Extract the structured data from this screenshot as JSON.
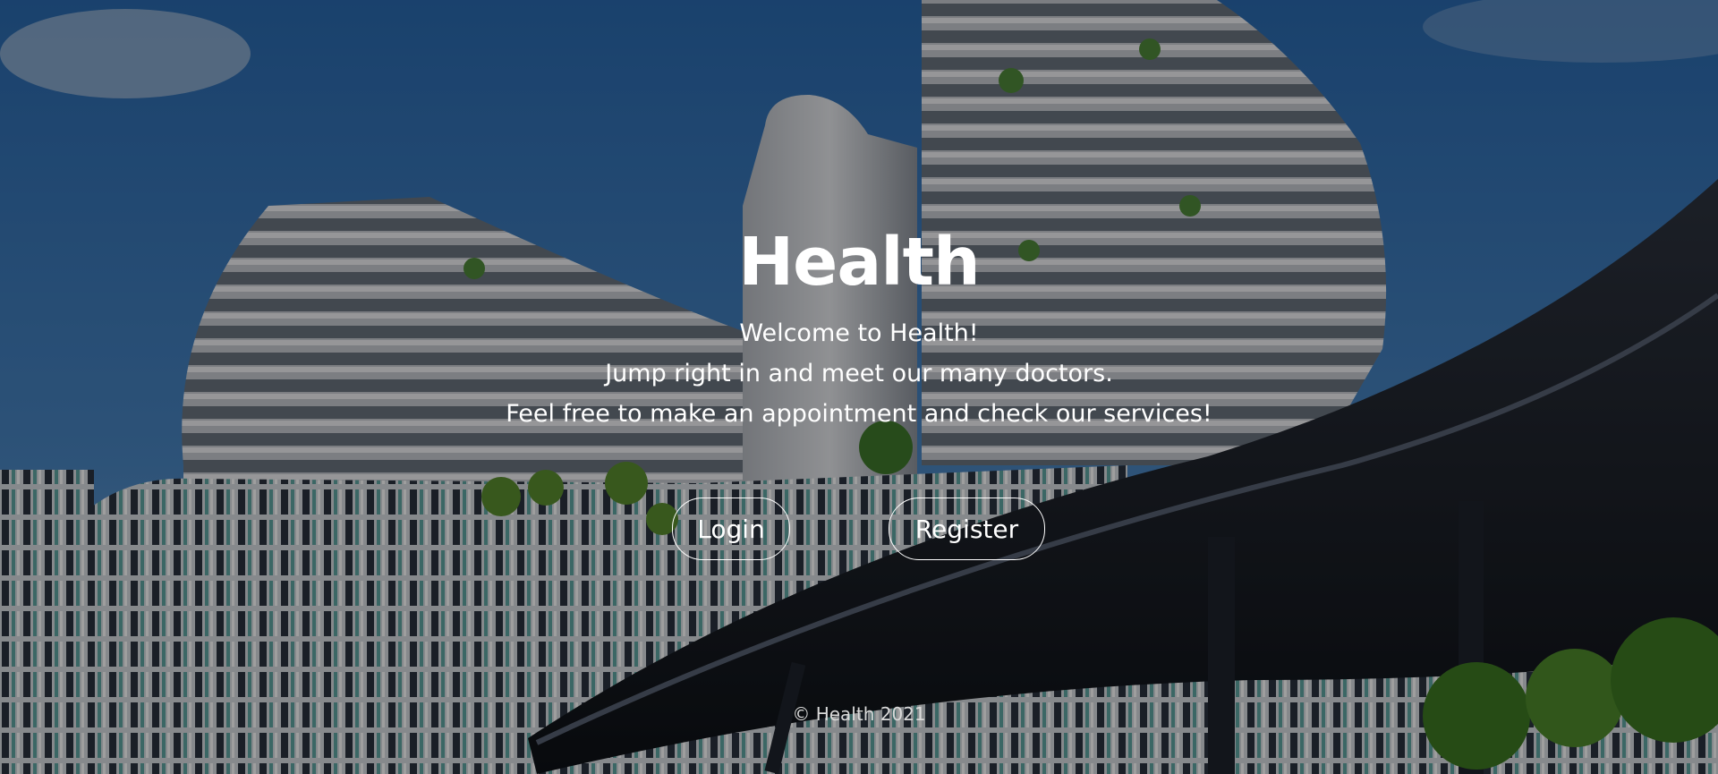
{
  "hero": {
    "title": "Health",
    "lines": [
      "Welcome to Health!",
      "Jump right in and meet our many doctors.",
      "Feel free to make an appointment and check our services!"
    ]
  },
  "buttons": {
    "login_label": "Login",
    "register_label": "Register"
  },
  "footer": {
    "copyright": "© Health 2021"
  },
  "colors": {
    "sky": "#2f6aa6",
    "overlay": "#000000",
    "text": "#ffffff"
  }
}
